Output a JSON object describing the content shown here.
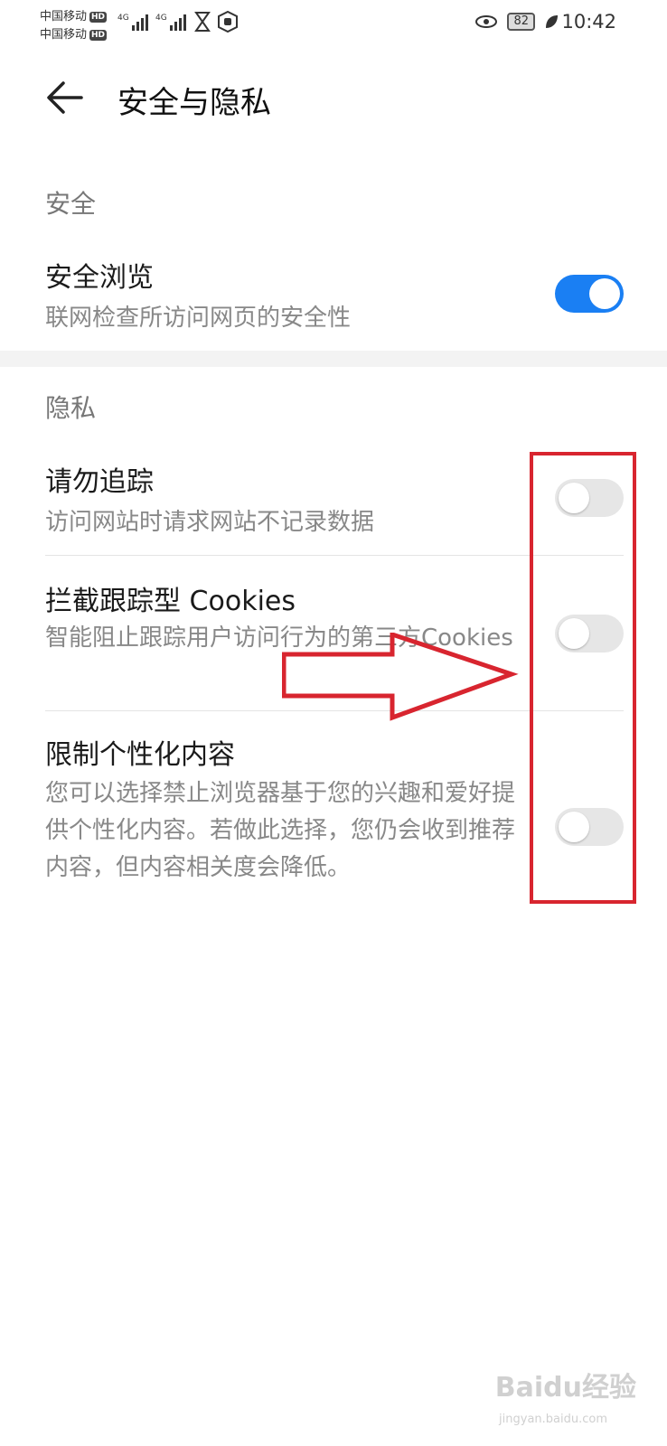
{
  "status_bar": {
    "carrier1": "中国移动",
    "carrier2": "中国移动",
    "hd_badge": "HD",
    "network": "4G",
    "battery": "82",
    "time": "10:42"
  },
  "app_bar": {
    "title": "安全与隐私"
  },
  "sections": [
    {
      "label": "安全",
      "items": [
        {
          "title": "安全浏览",
          "subtitle": "联网检查所访问网页的安全性",
          "enabled": true
        }
      ]
    },
    {
      "label": "隐私",
      "items": [
        {
          "title": "请勿追踪",
          "subtitle": "访问网站时请求网站不记录数据",
          "enabled": false
        },
        {
          "title": "拦截跟踪型 Cookies",
          "subtitle": "智能阻止跟踪用户访问行为的第三方Cookies",
          "enabled": false
        },
        {
          "title": "限制个性化内容",
          "subtitle": "您可以选择禁止浏览器基于您的兴趣和爱好提供个性化内容。若做此选择，您仍会收到推荐内容，但内容相关度会降低。",
          "enabled": false
        }
      ]
    }
  ],
  "watermark": {
    "brand": "Baidu经验",
    "url": "jingyan.baidu.com"
  },
  "colors": {
    "accent": "#1a7ff3",
    "annotation": "#d8252f",
    "switch_off": "#e6e6e6"
  }
}
